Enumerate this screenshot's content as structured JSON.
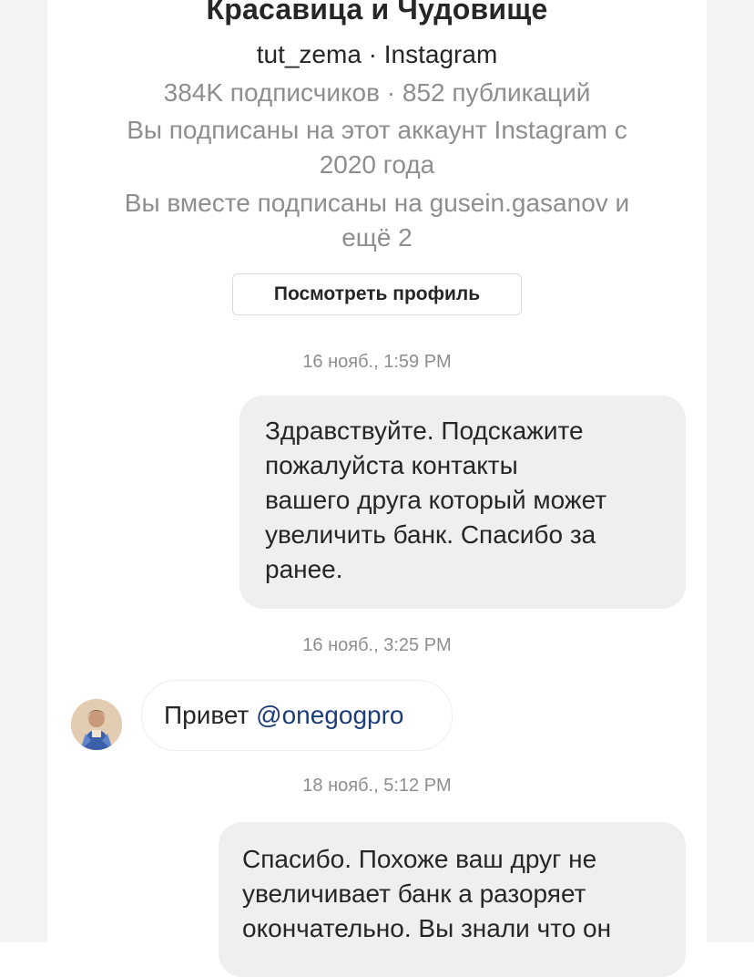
{
  "profile": {
    "name": "Красавица и Чудовище",
    "handle_line": "tut_zema · Instagram",
    "stats": "384K подписчиков · 852 публикаций",
    "follow_since_1": "Вы подписаны на этот аккаунт Instagram с",
    "follow_since_2": "2020 года",
    "mutual_1": "Вы вместе подписаны на gusein.gasanov и",
    "mutual_2": "ещё 2",
    "view_profile_label": "Посмотреть профиль"
  },
  "messages": [
    {
      "timestamp": "16 нояб., 1:59 PM",
      "direction": "outgoing",
      "lines": [
        "Здравствуйте. Подскажите",
        "пожалуйста контакты",
        "вашего друга который может",
        "увеличить банк. Спасибо за",
        "ранее."
      ]
    },
    {
      "timestamp": "16 нояб., 3:25 PM",
      "direction": "incoming",
      "text": "Привет ",
      "mention": "@onegogpro"
    },
    {
      "timestamp": "18 нояб., 5:12 PM",
      "direction": "outgoing",
      "lines": [
        "Спасибо. Похоже ваш друг не",
        "увеличивает банк а разоряет",
        "окончательно. Вы знали что он"
      ]
    }
  ],
  "colors": {
    "text": "#262626",
    "secondary": "#8e8e8e",
    "bubble_outgoing": "#efefef",
    "mention": "#1c3d7a"
  },
  "icons": {
    "avatar": "user-avatar"
  }
}
